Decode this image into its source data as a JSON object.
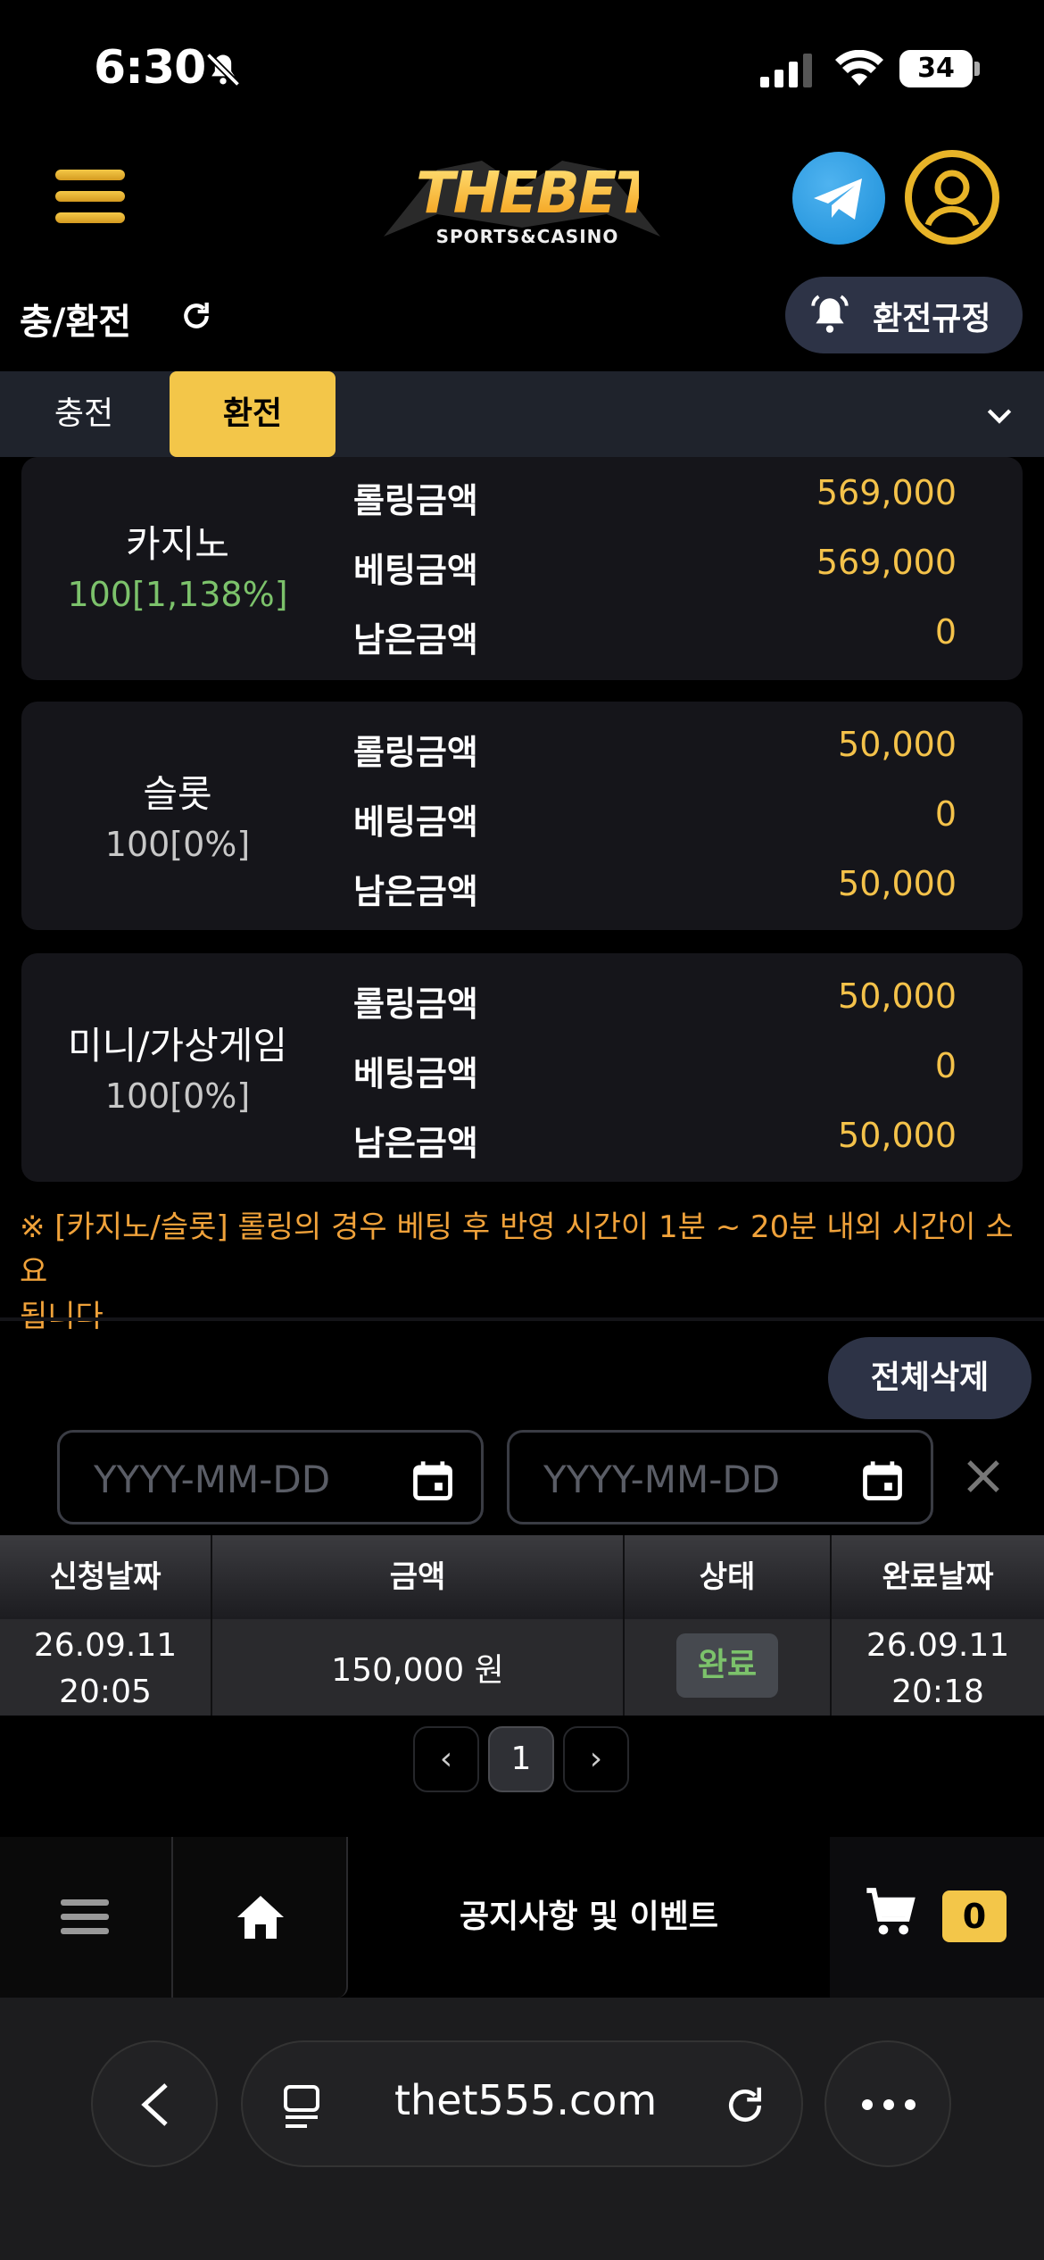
{
  "status_bar": {
    "time": "6:30",
    "battery": "34"
  },
  "header": {
    "logo_text": "THEBET",
    "logo_sub": "SPORTS&CASINO"
  },
  "page": {
    "title": "충/환전",
    "rules_label": "환전규정"
  },
  "tabs": [
    {
      "label": "충전",
      "active": false
    },
    {
      "label": "환전",
      "active": true
    }
  ],
  "cards": [
    {
      "name": "카지노",
      "percent": "100[1,138%]",
      "rows": [
        {
          "label": "롤링금액",
          "value": "569,000"
        },
        {
          "label": "베팅금액",
          "value": "569,000"
        },
        {
          "label": "남은금액",
          "value": "0"
        }
      ]
    },
    {
      "name": "슬롯",
      "percent": "100[0%]",
      "rows": [
        {
          "label": "롤링금액",
          "value": "50,000"
        },
        {
          "label": "베팅금액",
          "value": "0"
        },
        {
          "label": "남은금액",
          "value": "50,000"
        }
      ]
    },
    {
      "name": "미니/가상게임",
      "percent": "100[0%]",
      "rows": [
        {
          "label": "롤링금액",
          "value": "50,000"
        },
        {
          "label": "베팅금액",
          "value": "0"
        },
        {
          "label": "남은금액",
          "value": "50,000"
        }
      ]
    }
  ],
  "notice": {
    "line1": "※ [카지노/슬롯] 롤링의 경우 베팅 후 반영 시간이 1분 ~ 20분 내외 시간이 소요",
    "line2": "됩니다"
  },
  "filters": {
    "delete_all": "전체삭제",
    "start_placeholder": "YYYY-MM-DD",
    "end_placeholder": "YYYY-MM-DD"
  },
  "table": {
    "headers": [
      "신청날짜",
      "금액",
      "상태",
      "완료날짜"
    ],
    "rows": [
      {
        "request_date": "26.09.11",
        "request_time": "20:05",
        "amount": "150,000 원",
        "status": "완료",
        "complete_date": "26.09.11",
        "complete_time": "20:18"
      }
    ]
  },
  "pagination": {
    "prev": "‹",
    "current": "1",
    "next": "›"
  },
  "bottom_nav": {
    "notice_label": "공지사항 및 이벤트",
    "cart_count": "0"
  },
  "browser": {
    "url": "thet555.com"
  },
  "colors": {
    "accent": "#f3c649",
    "value_gold": "#f4c24a",
    "green": "#7cc26b",
    "notice_orange": "#f0a23a"
  }
}
